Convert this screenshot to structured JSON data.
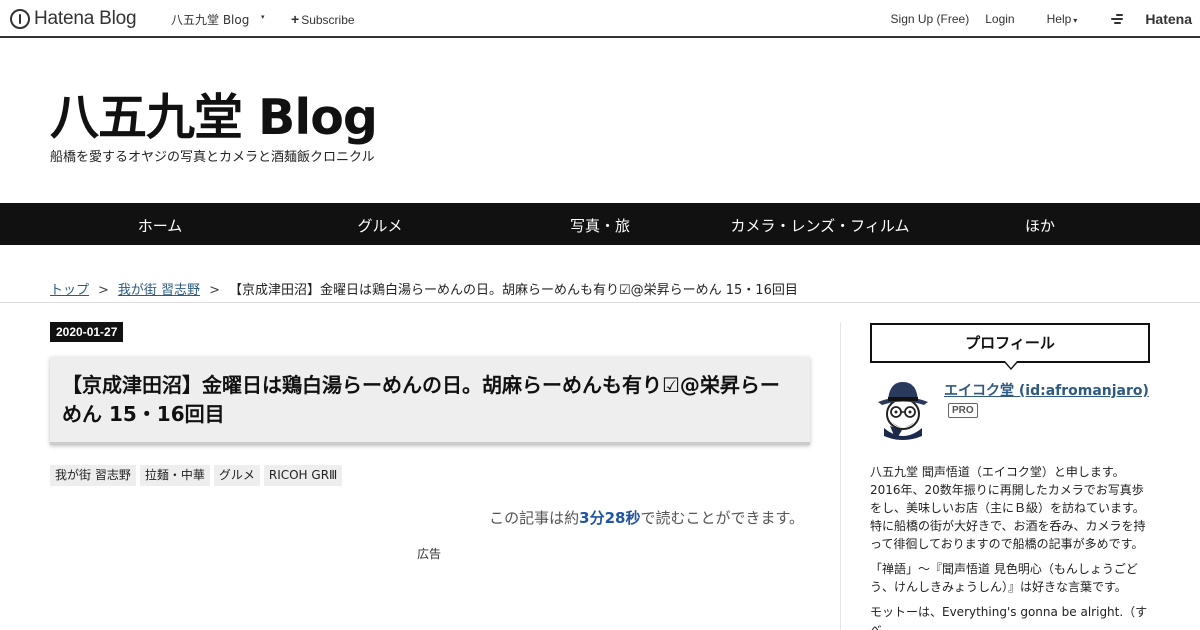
{
  "topbar": {
    "logo_text": "Hatena Blog",
    "blog_name": "八五九堂 Blog",
    "blog_caret": "▾",
    "subscribe_plus": "+",
    "subscribe_label": "Subscribe",
    "signup": "Sign Up (Free)",
    "login": "Login",
    "help": "Help",
    "help_caret": "▾",
    "hatena": "Hatena"
  },
  "header": {
    "title": "八五九堂 Blog",
    "description": "船橋を愛するオヤジの写真とカメラと酒麺飯クロニクル"
  },
  "nav": {
    "items": [
      {
        "label": "ホーム"
      },
      {
        "label": "グルメ"
      },
      {
        "label": "写真・旅"
      },
      {
        "label": "カメラ・レンズ・フィルム"
      },
      {
        "label": "ほか"
      }
    ]
  },
  "breadcrumb": {
    "top": "トップ",
    "sep": ">",
    "category": "我が街 習志野",
    "current": "【京成津田沼】金曜日は鶏白湯らーめんの日。胡麻らーめんも有り☑@栄昇らーめん 15・16回目"
  },
  "article": {
    "date": "2020-01-27",
    "title": "【京成津田沼】金曜日は鶏白湯らーめんの日。胡麻らーめんも有り☑@栄昇らーめん 15・16回目",
    "categories": [
      "我が街 習志野",
      "拉麺・中華",
      "グルメ",
      "RICOH GRⅢ"
    ],
    "readtime_prefix": "この記事は約",
    "readtime_value": "3分28秒",
    "readtime_suffix": "で読むことができます。",
    "ad_label": "広告"
  },
  "sidebar": {
    "profile_heading": "プロフィール",
    "user_name": "エイコク堂 (id:afromanjaro)",
    "pro_badge": "PRO",
    "bio_1": "八五九堂 聞声悟道（エイコク堂）と申します。2016年、20数年振りに再開したカメラでお写真歩をし、美味しいお店（主にＢ級）を訪ねています。特に船橋の街が大好きで、お酒を呑み、カメラを持って徘徊しておりますので船橋の記事が多めです。",
    "bio_2": "「禅語」～『聞声悟道 見色明心（もんしょうごどう、けんしきみょうしん）』は好きな言葉です。",
    "bio_3": "モットーは、Everything's gonna be alright.（すべ"
  }
}
